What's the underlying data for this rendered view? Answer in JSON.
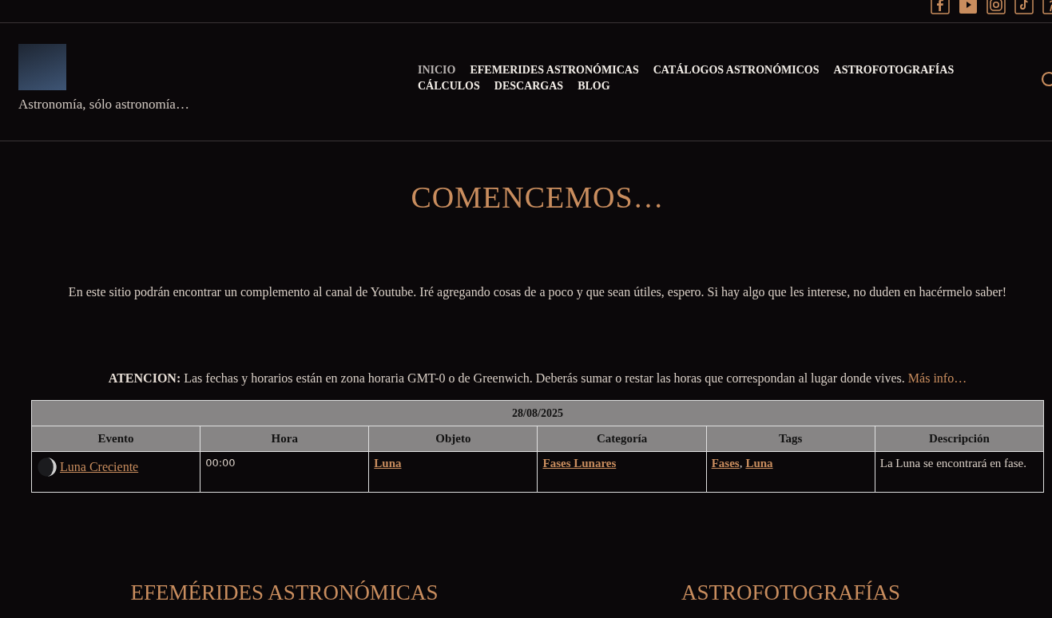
{
  "tagline": "Astronomía, sólo astronomía…",
  "nav": [
    {
      "label": "INICIO",
      "selected": true
    },
    {
      "label": "EFEMERIDES ASTRONÓMICAS",
      "selected": false
    },
    {
      "label": "CATÁLOGOS ASTRONÓMICOS",
      "selected": false
    },
    {
      "label": "ASTROFOTOGRAFÍAS",
      "selected": false
    },
    {
      "label": "CÁLCULOS",
      "selected": false
    },
    {
      "label": "DESCARGAS",
      "selected": false
    },
    {
      "label": "BLOG",
      "selected": false
    }
  ],
  "heading": "COMENCEMOS…",
  "intro": "En este sitio podrán encontrar un complemento al canal de Youtube. Iré agregando cosas de a poco y que sean útiles, espero. Si hay algo que les interese, no duden en hacérmelo saber!",
  "notice": {
    "text": "**ATENCION:** Las fechas y horarios están en zona horaria GMT-0 o de Greenwich. Deberás sumar o restar las horas que correspondan al lugar donde vives.",
    "link": "Más info…"
  },
  "table": {
    "date": "28/08/2025",
    "columns": [
      "Evento",
      "Hora",
      "Objeto",
      "Categoría",
      "Tags",
      "Descripción"
    ],
    "rows": [
      {
        "event": "Luna Creciente",
        "time": "00:00",
        "object": [
          "Luna"
        ],
        "category": [
          "Fases Lunares"
        ],
        "tags": [
          "Fases",
          "Luna"
        ],
        "tag_separator": ",",
        "description": "La Luna se encontrará en fase."
      }
    ]
  },
  "sections": [
    "EFEMÉRIDES ASTRONÓMICAS",
    "ASTROFOTOGRAFÍAS"
  ]
}
